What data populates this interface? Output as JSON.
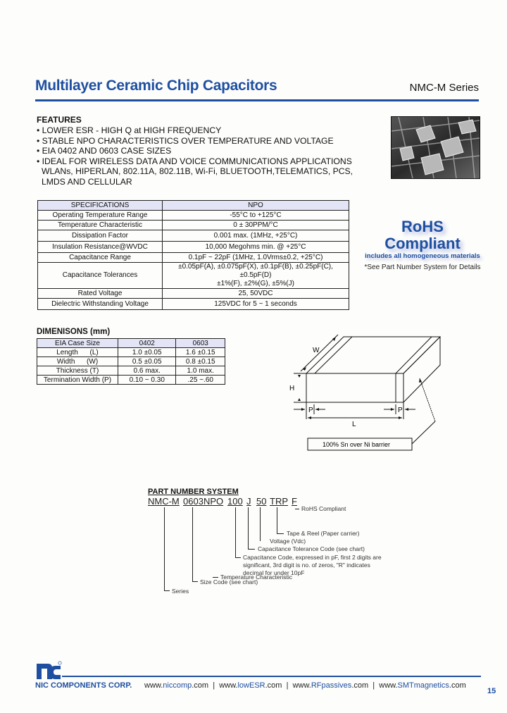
{
  "header": {
    "title": "Multilayer Ceramic Chip Capacitors",
    "series": "NMC-M Series",
    "accent_color": "#1e4fa1"
  },
  "features": {
    "heading": "FEATURES",
    "items": [
      "• LOWER ESR - HIGH Q at HIGH FREQUENCY",
      "• STABLE NPO CHARACTERISTICS OVER TEMPERATURE AND VOLTAGE",
      "• EIA 0402 AND 0603 CASE SIZES",
      "• IDEAL FOR WIRELESS DATA AND VOICE COMMUNICATIONS APPLICATIONS",
      "  WLANs, HIPERLAN, 802.11A, 802.11B, Wi-Fi, BLUETOOTH,TELEMATICS, PCS,",
      "  LMDS AND CELLULAR"
    ]
  },
  "rohs": {
    "line1": "RoHS",
    "line2": "Compliant",
    "line3": "includes all homogeneous materials",
    "note": "*See Part Number System for Details"
  },
  "specifications": {
    "headers": [
      "SPECIFICATIONS",
      "NPO"
    ],
    "rows": [
      [
        "Operating Temperature Range",
        "-55°C to +125°C"
      ],
      [
        "Temperature Characteristic",
        "0 ± 30PPM/°C"
      ],
      [
        "Dissipation Factor",
        "0.001 max. (1MHz, +25°C)"
      ],
      [
        "Insulation Resistance@WVDC",
        "10,000 Megohms min. @ +25°C"
      ],
      [
        "Capacitance Range",
        "0.1pF ~ 22pF (1MHz, 1.0Vrms±0.2, +25°C)"
      ],
      [
        "Capacitance Tolerances",
        "±0.05pF(A), ±0.075pF(X), ±0.1pF(B), ±0.25pF(C), ±0.5pF(D)",
        "±1%(F), ±2%(G), ±5%(J)"
      ],
      [
        "Rated Voltage",
        "25, 50VDC"
      ],
      [
        "Dielectric Withstanding Voltage",
        "125VDC for 5 ~ 1 seconds"
      ]
    ]
  },
  "dimensions": {
    "heading": "DIMENISONS (mm)",
    "headers": [
      "EIA Case Size",
      "0402",
      "0603"
    ],
    "rows": [
      [
        "Length      (L)",
        "1.0 ±0.05",
        "1.6 ±0.15"
      ],
      [
        "Width      (W)",
        "0.5 ±0.05",
        "0.8 ±0.15"
      ],
      [
        "Thickness (T)",
        "0.6 max.",
        "1.0 max."
      ],
      [
        "Termination Width (P)",
        "0.10 ~ 0.30",
        ".25 ~.60"
      ]
    ]
  },
  "diagram": {
    "label_w": "W",
    "label_h": "H",
    "label_p": "P",
    "label_l": "L",
    "callout": "100% Sn over Ni barrier"
  },
  "part_number_system": {
    "heading": "PART NUMBER SYSTEM",
    "codes": [
      "NMC-M",
      "0603",
      "NPO",
      "100",
      "J",
      "50",
      "TRP",
      "F"
    ],
    "descriptions": {
      "rohs": "RoHS Compliant",
      "tape": "Tape & Reel (Paper carrier)",
      "voltage": "Voltage (Vdc)",
      "tolerance": "Capacitance Tolerance Code (see chart)",
      "capacitance_1": "Capacitance Code, expressed in pF, first 2 digits are",
      "capacitance_2": "significant, 3rd digit is no. of zeros, \"R\" indicates",
      "capacitance_3": "decimal for under 10pF",
      "temperature": "Temperature Characteristic",
      "size": "Size Code (see chart)",
      "series": "Series"
    }
  },
  "footer": {
    "logo": "nc",
    "company": "NIC COMPONENTS CORP.",
    "links": [
      {
        "pre": "www.",
        "brand": "niccomp",
        "post": ".com"
      },
      {
        "pre": "www.",
        "brand": "lowESR",
        "post": ".com"
      },
      {
        "pre": "www.",
        "brand": "RFpassives",
        "post": ".com"
      },
      {
        "pre": "www.",
        "brand": "SMTmagnetics",
        "post": ".com"
      }
    ],
    "separator": "|",
    "page_number": "15"
  }
}
